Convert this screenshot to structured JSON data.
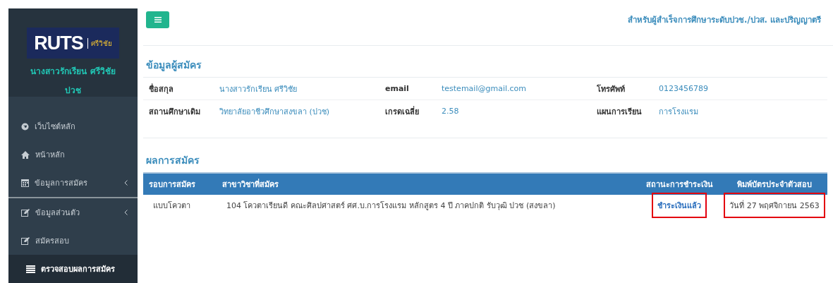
{
  "sidebar": {
    "logo": {
      "mark": "RUTS",
      "subtitle": "ศรีวิชัย"
    },
    "user_name": "นางสาวรักเรียน ศรีวิชัย",
    "user_level": "ปวช",
    "items": [
      {
        "label": "เว็บไซต์หลัก",
        "has_submenu": false,
        "selected": false
      },
      {
        "label": "หน้าหลัก",
        "has_submenu": false,
        "selected": false
      },
      {
        "label": "ข้อมูลการสมัคร",
        "has_submenu": true,
        "selected": false
      },
      {
        "label": "ข้อมูลส่วนตัว",
        "has_submenu": true,
        "selected": false
      },
      {
        "label": "สมัครสอบ",
        "has_submenu": false,
        "selected": false
      },
      {
        "label": "ตรวจสอบผลการสมัคร",
        "has_submenu": false,
        "selected": true
      }
    ]
  },
  "header": {
    "tagline": "สำหรับผู้สำเร็จการศึกษาระดับปวช./ปวส. และปริญญาตรี"
  },
  "applicant": {
    "title": "ข้อมูลผู้สมัคร",
    "rows": [
      [
        {
          "label": "ชื่อสกุล",
          "value": "นางสาวรักเรียน ศรีวิชัย"
        },
        {
          "label": "email",
          "value": "testemail@gmail.com"
        },
        {
          "label": "โทรศัพท์",
          "value": "0123456789"
        }
      ],
      [
        {
          "label": "สถานศึกษาเดิม",
          "value": "วิทยาลัยอาชีวศึกษาสงขลา (ปวช)"
        },
        {
          "label": "เกรดเฉลี่ย",
          "value": "2.58"
        },
        {
          "label": "แผนการเรียน",
          "value": "การโรงแรม"
        }
      ]
    ]
  },
  "results": {
    "title": "ผลการสมัคร",
    "columns": [
      "รอบการสมัคร",
      "สาขาวิชาที่สมัคร",
      "สถานะการชำระเงิน",
      "พิมพ์บัตรประจำตัวสอบ"
    ],
    "rows": [
      {
        "cells": [
          {
            "text": "แบบโควตา",
            "highlighted": false
          },
          {
            "text": "104 โควตาเรียนดี คณะศิลปศาสตร์ ศศ.บ.การโรงแรม หลักสูตร 4 ปี ภาคปกติ รับวุฒิ ปวช (สงขลา)",
            "highlighted": false
          },
          {
            "text": "ชำระเงินแล้ว",
            "highlighted": true
          },
          {
            "text": "วันที่ 27 พฤศจิกายน 2563",
            "highlighted": true
          }
        ]
      }
    ]
  }
}
